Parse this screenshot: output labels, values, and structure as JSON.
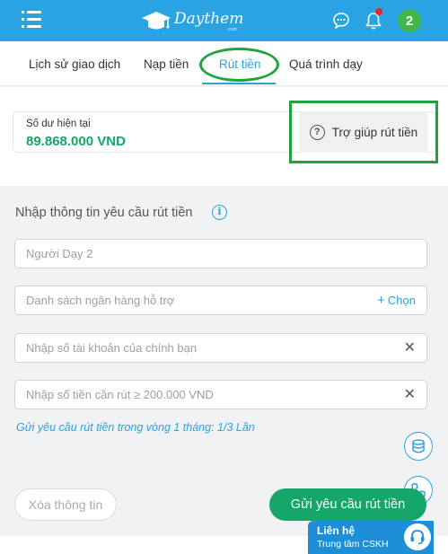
{
  "header": {
    "logo_text": "Daythem",
    "logo_sub": ".com",
    "avatar_label": "2",
    "accent_color": "#29a3e1",
    "notification_dot_color": "#e6262b"
  },
  "tabs": [
    {
      "label": "Lịch sử giao dịch",
      "active": false
    },
    {
      "label": "Nạp tiền",
      "active": false
    },
    {
      "label": "Rút tiền",
      "active": true
    },
    {
      "label": "Quá trình dạy",
      "active": false
    }
  ],
  "balance": {
    "label": "Số dư hiện tại",
    "value": "89.868.000 VND",
    "value_color": "#16a566"
  },
  "help_button": {
    "label": "Trợ giúp rút tiền",
    "icon": "question-circle-icon"
  },
  "form": {
    "title": "Nhập thông tin yêu cầu rút tiền",
    "name_field": {
      "placeholder": "Người Dạy 2"
    },
    "bank_field": {
      "placeholder": "Danh sách ngân hàng hỗ trợ",
      "action_label": "Chọn",
      "action_icon": "plus-icon"
    },
    "account_field": {
      "placeholder": "Nhập số tài khoản của chính bạn"
    },
    "amount_field": {
      "placeholder": "Nhập số tiền cần rút ≥ 200.000 VND"
    },
    "limit_note": "Gửi yêu cầu rút tiền trong vòng 1 tháng: 1/3 Lần",
    "clear_label": "Xóa thông tin",
    "submit_label": "Gửi yêu cầu rút tiền",
    "submit_color": "#15a66a"
  },
  "contact": {
    "title": "Liên hệ",
    "subtitle": "Trung tâm CSKH",
    "icon": "headset-icon"
  },
  "annotations": {
    "highlight_color": "#1fa33c"
  }
}
